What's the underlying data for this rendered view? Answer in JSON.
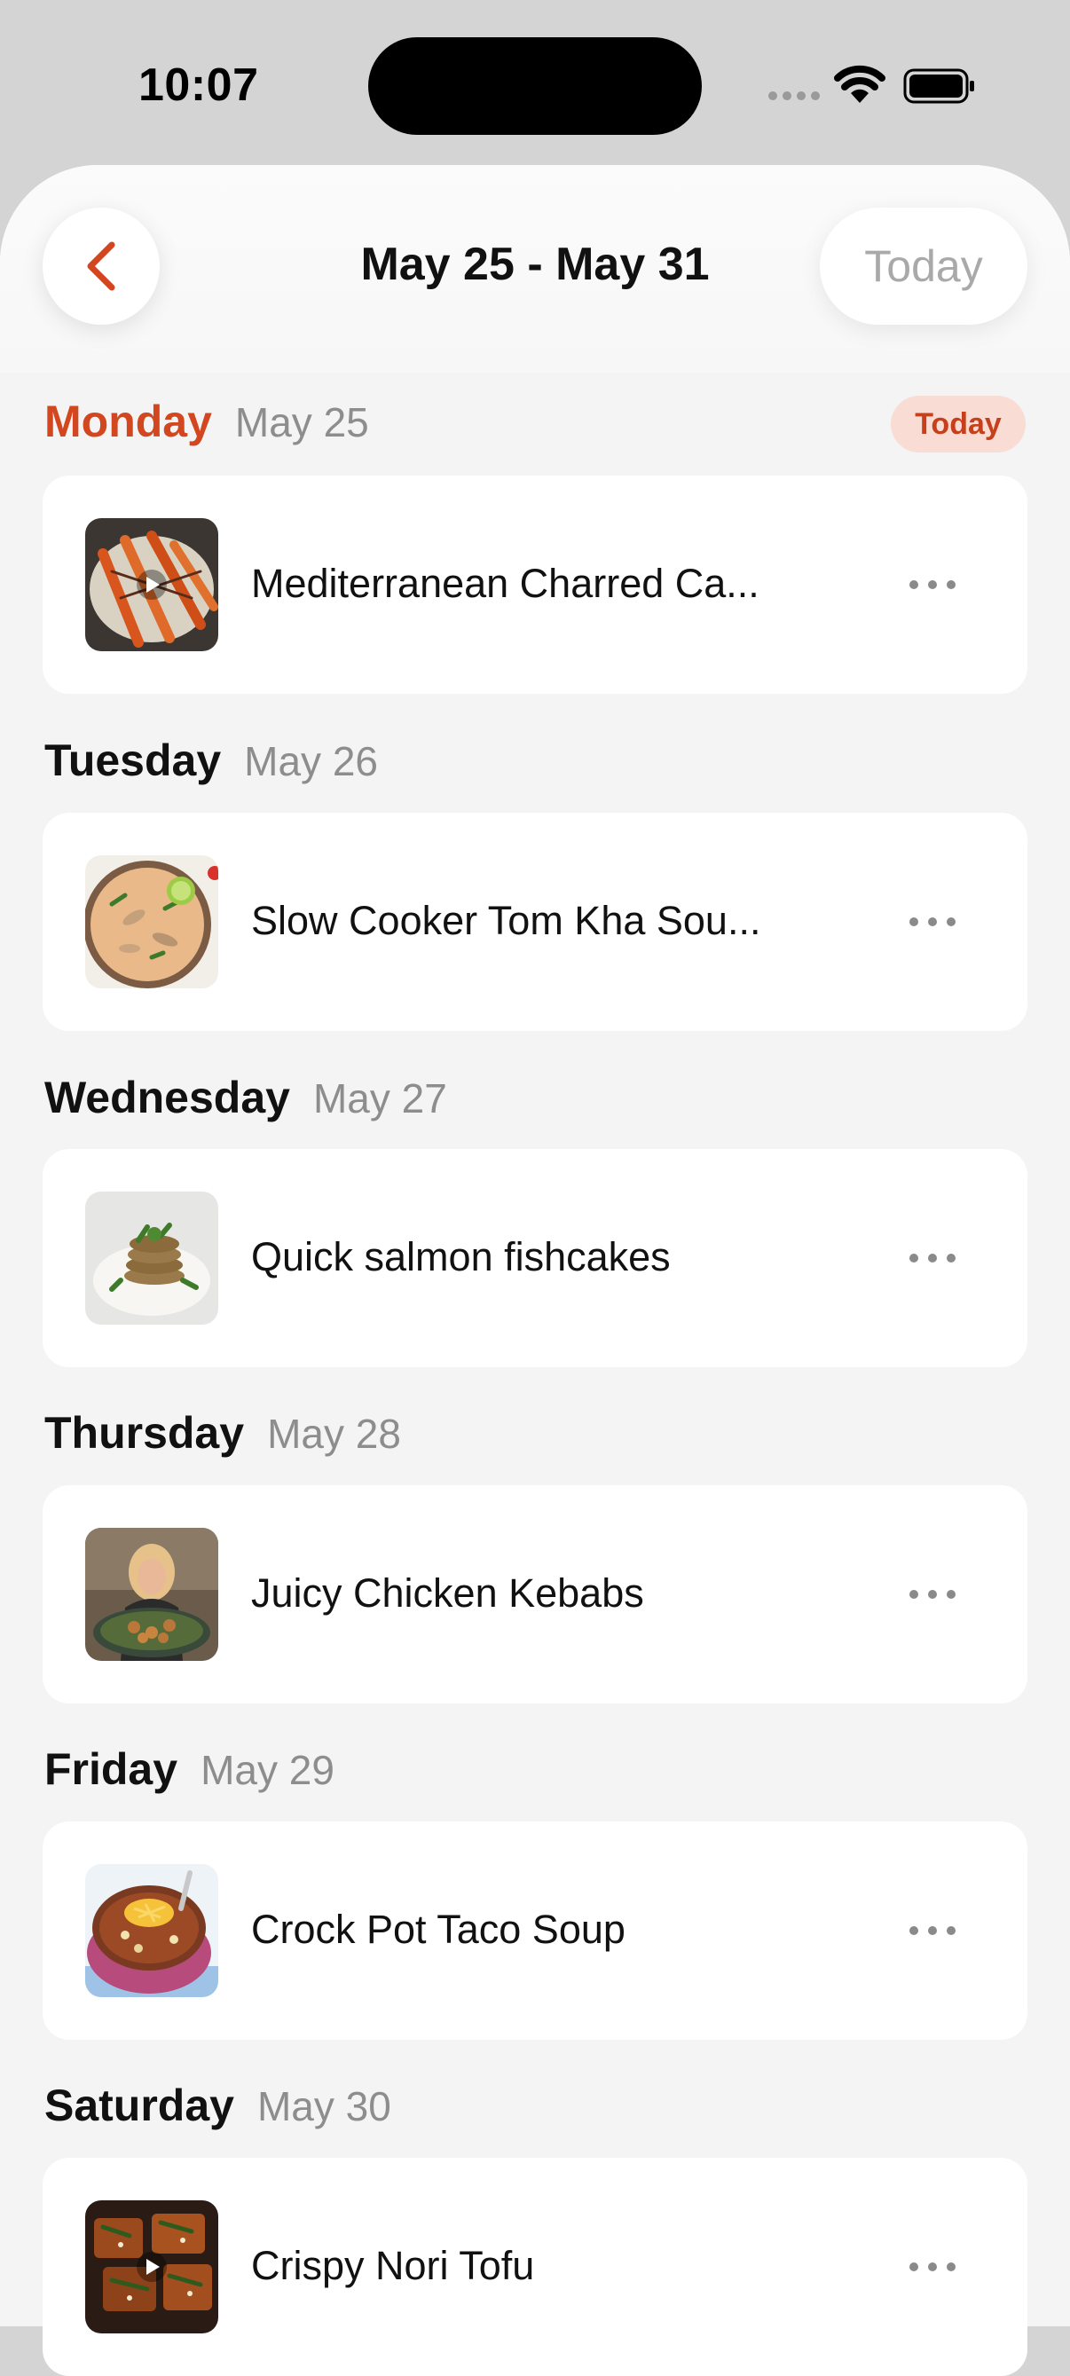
{
  "status_bar": {
    "time": "10:07"
  },
  "header": {
    "title": "May 25 - May 31",
    "today_button": "Today"
  },
  "badge": {
    "today": "Today"
  },
  "colors": {
    "accent": "#d2471f",
    "badge_bg": "#f9ddd4"
  },
  "days": [
    {
      "name": "Monday",
      "date": "May 25",
      "recipe": "Mediterranean Charred Ca...",
      "thumb_icon": "charred-carrots-photo"
    },
    {
      "name": "Tuesday",
      "date": "May 26",
      "recipe": "Slow Cooker Tom Kha Sou...",
      "thumb_icon": "tom-kha-soup-photo"
    },
    {
      "name": "Wednesday",
      "date": "May 27",
      "recipe": "Quick salmon fishcakes",
      "thumb_icon": "salmon-fishcakes-photo"
    },
    {
      "name": "Thursday",
      "date": "May 28",
      "recipe": "Juicy Chicken Kebabs",
      "thumb_icon": "chicken-kebabs-photo"
    },
    {
      "name": "Friday",
      "date": "May 29",
      "recipe": "Crock Pot Taco Soup",
      "thumb_icon": "taco-soup-photo"
    },
    {
      "name": "Saturday",
      "date": "May 30",
      "recipe": "Crispy Nori Tofu",
      "thumb_icon": "nori-tofu-photo"
    }
  ]
}
